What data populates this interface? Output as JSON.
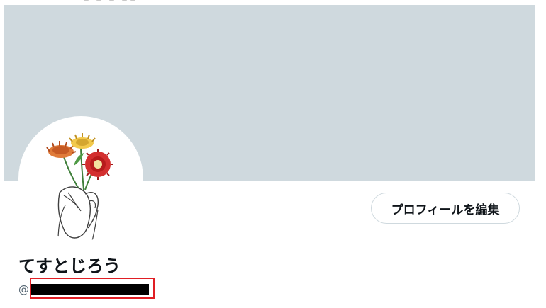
{
  "profile": {
    "display_name": "てすとじろう",
    "handle_prefix": "@",
    "handle_redacted": true,
    "edit_button_label": "プロフィールを編集"
  },
  "colors": {
    "banner": "#cfd9de",
    "text_primary": "#0f1419",
    "text_secondary": "#536471",
    "button_border": "#cfd9de",
    "highlight": "#e01e24",
    "flower_orange": "#e07b39",
    "flower_yellow": "#f2c94c",
    "flower_red": "#d32f2f"
  },
  "icons": {
    "avatar": "flower-bouquet-illustration"
  }
}
